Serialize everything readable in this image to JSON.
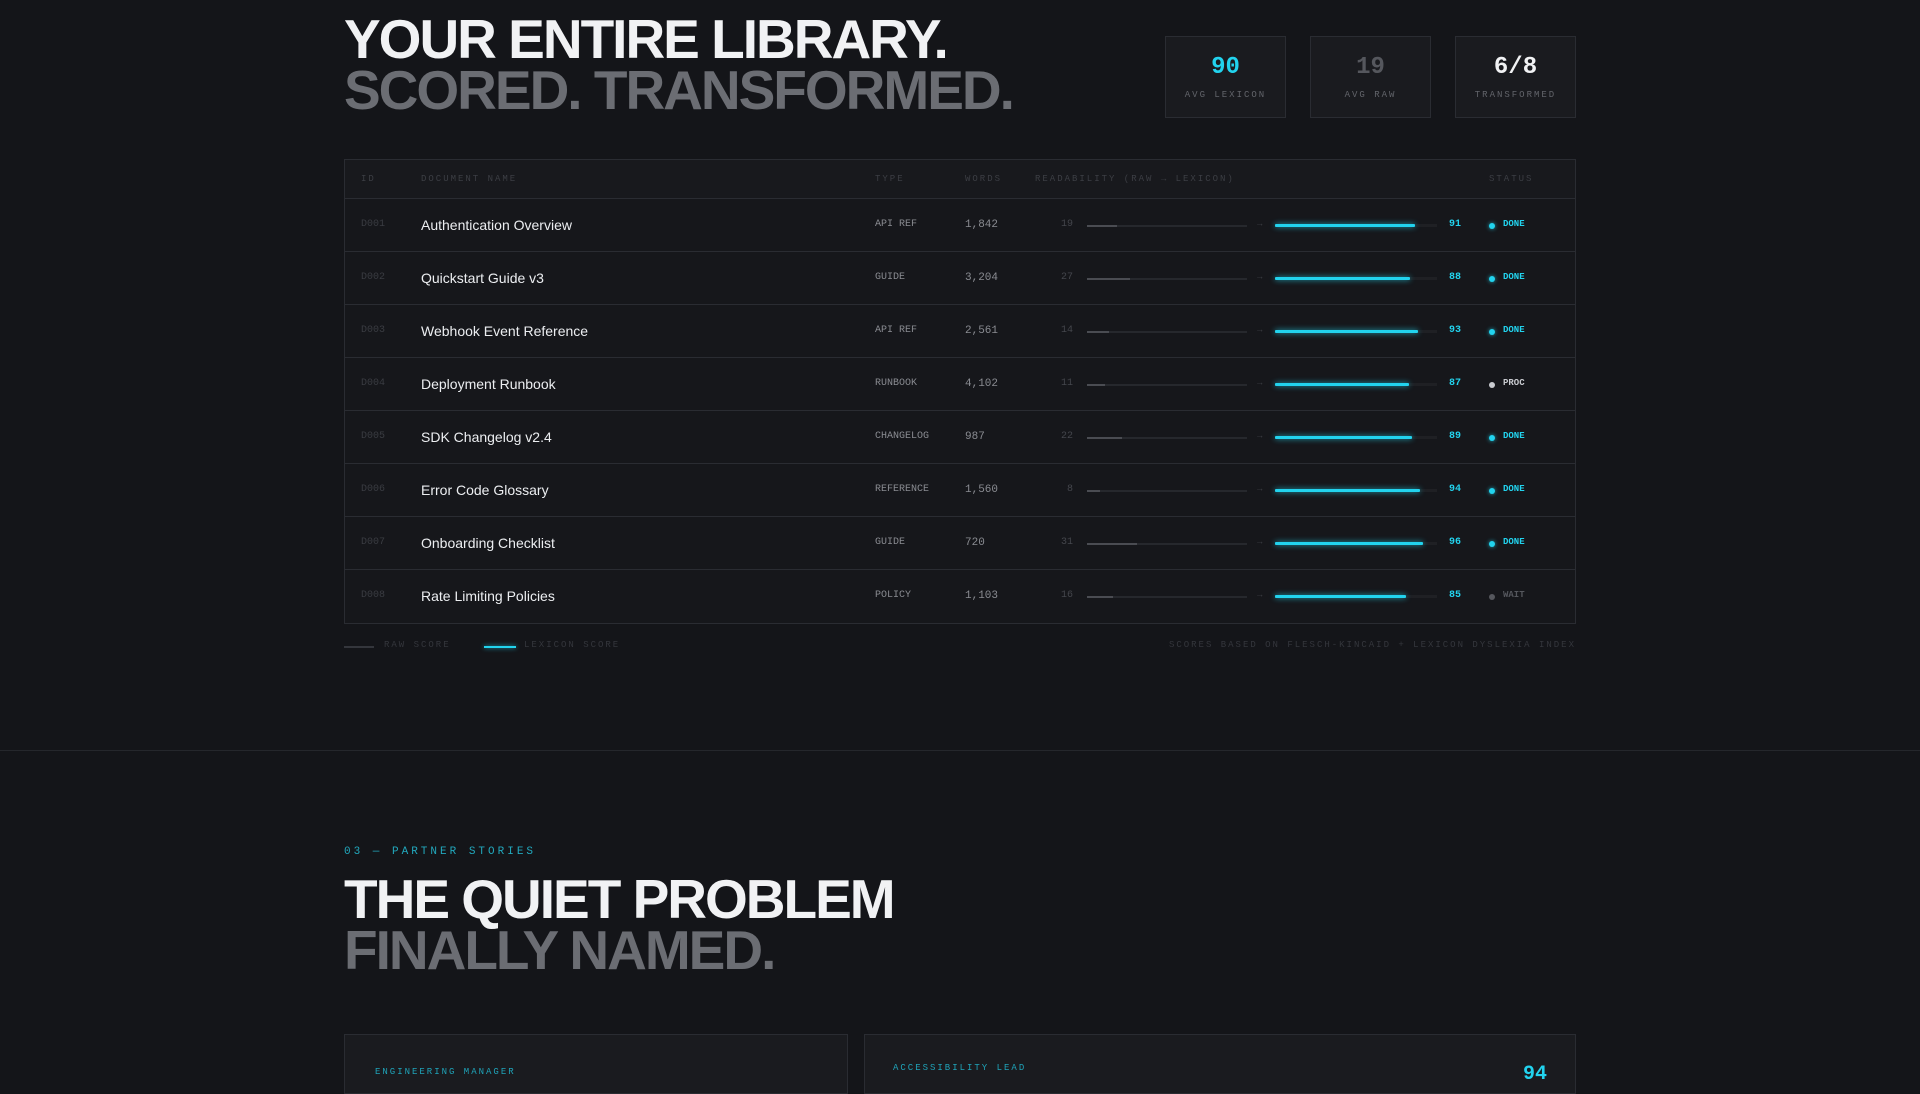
{
  "hero": {
    "line1": "YOUR ENTIRE LIBRARY.",
    "line2": "SCORED. TRANSFORMED.",
    "stats": [
      {
        "value": "90",
        "label": "AVG LEXICON",
        "color": "#22d3ee"
      },
      {
        "value": "19",
        "label": "AVG RAW",
        "color": "#55575d"
      },
      {
        "value": "6/8",
        "label": "TRANSFORMED",
        "color": "#f1f2f4"
      }
    ]
  },
  "table": {
    "headers": {
      "id": "ID",
      "name": "DOCUMENT NAME",
      "type": "TYPE",
      "words": "WORDS",
      "readability": "READABILITY (RAW → LEXICON)",
      "status": "STATUS"
    },
    "rows": [
      {
        "id": "D001",
        "name": "Authentication Overview",
        "type": "API REF",
        "words": "1,842",
        "raw": 19,
        "lexicon": 91,
        "status": "DONE"
      },
      {
        "id": "D002",
        "name": "Quickstart Guide v3",
        "type": "GUIDE",
        "words": "3,204",
        "raw": 27,
        "lexicon": 88,
        "status": "DONE"
      },
      {
        "id": "D003",
        "name": "Webhook Event Reference",
        "type": "API REF",
        "words": "2,561",
        "raw": 14,
        "lexicon": 93,
        "status": "DONE"
      },
      {
        "id": "D004",
        "name": "Deployment Runbook",
        "type": "RUNBOOK",
        "words": "4,102",
        "raw": 11,
        "lexicon": 87,
        "status": "PROC"
      },
      {
        "id": "D005",
        "name": "SDK Changelog v2.4",
        "type": "CHANGELOG",
        "words": "987",
        "raw": 22,
        "lexicon": 89,
        "status": "DONE"
      },
      {
        "id": "D006",
        "name": "Error Code Glossary",
        "type": "REFERENCE",
        "words": "1,560",
        "raw": 8,
        "lexicon": 94,
        "status": "DONE"
      },
      {
        "id": "D007",
        "name": "Onboarding Checklist",
        "type": "GUIDE",
        "words": "720",
        "raw": 31,
        "lexicon": 96,
        "status": "DONE"
      },
      {
        "id": "D008",
        "name": "Rate Limiting Policies",
        "type": "POLICY",
        "words": "1,103",
        "raw": 16,
        "lexicon": 85,
        "status": "WAIT"
      }
    ],
    "arrow": "→"
  },
  "legend": {
    "raw": "RAW SCORE",
    "lexicon": "LEXICON SCORE",
    "note": "SCORES BASED ON FLESCH-KINCAID + LEXICON DYSLEXIA INDEX"
  },
  "colors": {
    "accent": "#22d3ee",
    "done": "#22d3ee",
    "proc": "#c9cbd0",
    "wait": "#55575d"
  },
  "section2": {
    "eyebrow": "03 — PARTNER STORIES",
    "line1": "THE QUIET PROBLEM",
    "line2": "FINALLY NAMED.",
    "cards": [
      {
        "role": "ENGINEERING MANAGER",
        "score": ""
      },
      {
        "role": "ACCESSIBILITY LEAD",
        "score": "94"
      }
    ]
  }
}
